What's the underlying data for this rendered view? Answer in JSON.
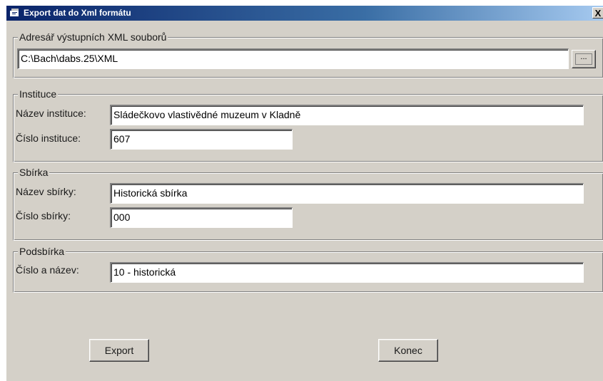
{
  "window": {
    "title": "Export dat do Xml formátu",
    "close_label": "X"
  },
  "output_dir": {
    "legend": "Adresář výstupních XML souborů",
    "path_value": "C:\\Bach\\dabs.25\\XML",
    "browse_label": "..."
  },
  "institution": {
    "legend": "Instituce",
    "name_label": "Název instituce:",
    "name_value": "Sládečkovo vlastivědné muzeum v Kladně",
    "number_label": "Číslo instituce:",
    "number_value": "607"
  },
  "collection": {
    "legend": "Sbírka",
    "name_label": "Název sbírky:",
    "name_value": "Historická sbírka",
    "number_label": "Číslo sbírky:",
    "number_value": "000"
  },
  "subcollection": {
    "legend": "Podsbírka",
    "label": "Číslo a název:",
    "value": "10 - historická"
  },
  "buttons": {
    "export_label": "Export",
    "close_label": "Konec"
  }
}
